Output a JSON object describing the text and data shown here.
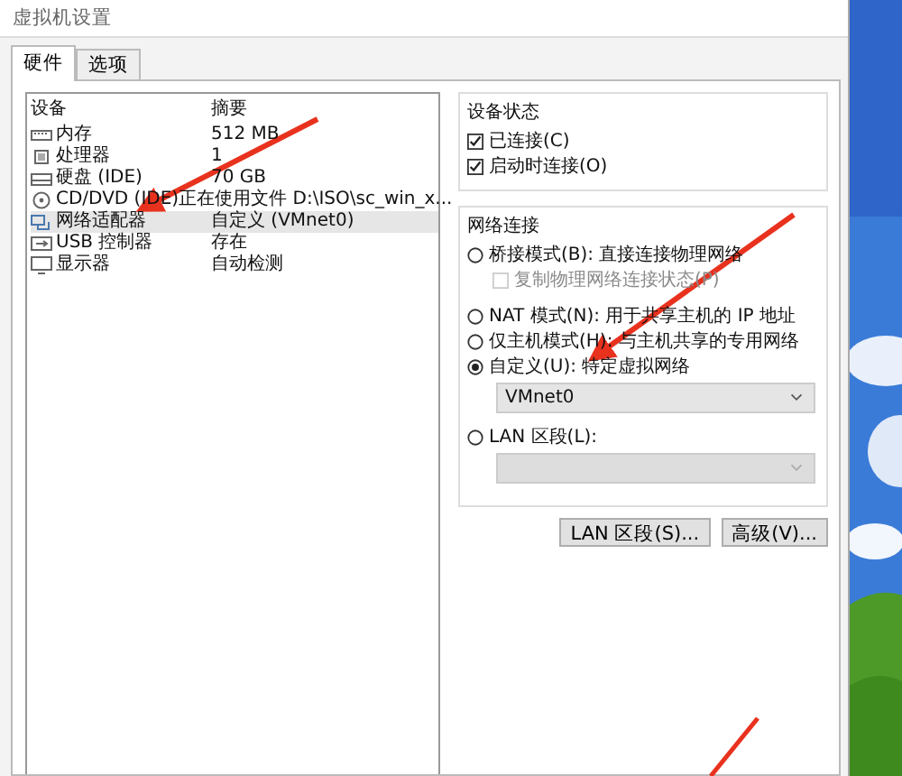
{
  "window": {
    "title": "虚拟机设置"
  },
  "tabs": [
    {
      "label": "硬件",
      "selected": true
    },
    {
      "label": "选项",
      "selected": false
    }
  ],
  "device_list": {
    "columns": [
      "设备",
      "摘要"
    ],
    "rows": [
      {
        "name": "内存",
        "summary": "512 MB",
        "selected": false
      },
      {
        "name": "处理器",
        "summary": "1",
        "selected": false
      },
      {
        "name": "硬盘 (IDE)",
        "summary": "70 GB",
        "selected": false
      },
      {
        "name": "CD/DVD (IDE)",
        "summary": "正在使用文件 D:\\ISO\\sc_win_x...",
        "selected": false
      },
      {
        "name": "网络适配器",
        "summary": "自定义 (VMnet0)",
        "selected": true
      },
      {
        "name": "USB 控制器",
        "summary": "存在",
        "selected": false
      },
      {
        "name": "显示器",
        "summary": "自动检测",
        "selected": false
      }
    ]
  },
  "device_status": {
    "title": "设备状态",
    "options": [
      {
        "label": "已连接(C)",
        "checked": true
      },
      {
        "label": "启动时连接(O)",
        "checked": true
      }
    ]
  },
  "network_connection": {
    "title": "网络连接",
    "options": [
      {
        "kind": "radio",
        "label": "桥接模式(B): 直接连接物理网络",
        "selected": false
      },
      {
        "kind": "checkbox",
        "label": "复制物理网络连接状态(P)",
        "checked": false,
        "disabled": true
      },
      {
        "kind": "radio",
        "label": "NAT 模式(N): 用于共享主机的 IP 地址",
        "selected": false
      },
      {
        "kind": "radio",
        "label": "仅主机模式(H): 与主机共享的专用网络",
        "selected": false
      },
      {
        "kind": "radio",
        "label": "自定义(U): 特定虚拟网络",
        "selected": true
      },
      {
        "kind": "dropdown",
        "value": "VMnet0",
        "disabled": false
      },
      {
        "kind": "radio",
        "label": "LAN 区段(L):",
        "selected": false
      },
      {
        "kind": "dropdown",
        "disabled": true
      }
    ]
  },
  "buttons": [
    "LAN 区段(S)...",
    "高级(V)..."
  ]
}
